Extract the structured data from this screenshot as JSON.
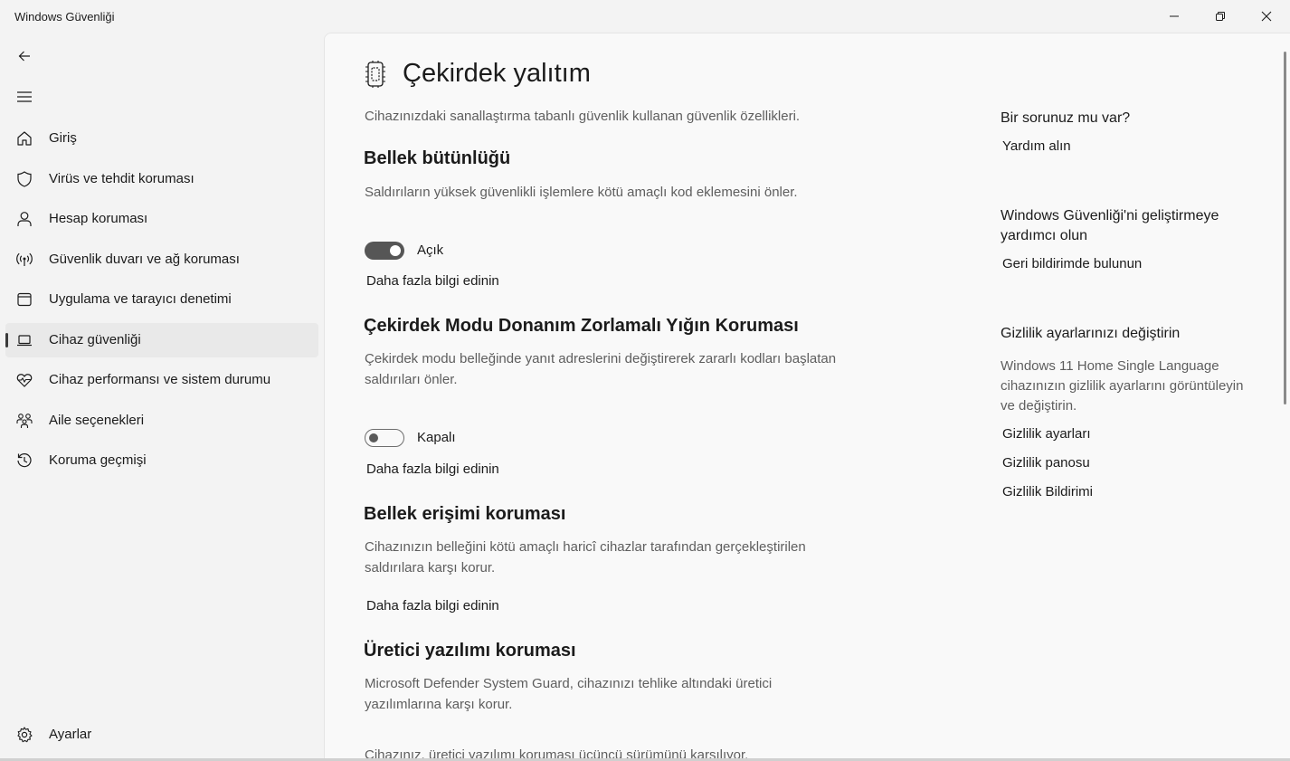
{
  "window": {
    "title": "Windows Güvenliği",
    "controls": [
      "minimize-icon",
      "restore-icon",
      "close-icon"
    ]
  },
  "sidebar": {
    "back_icon": "back-arrow-icon",
    "menu_icon": "hamburger-menu-icon",
    "items": [
      {
        "label": "Giriş",
        "icon": "home-icon"
      },
      {
        "label": "Virüs ve tehdit koruması",
        "icon": "shield-icon"
      },
      {
        "label": "Hesap koruması",
        "icon": "person-icon"
      },
      {
        "label": "Güvenlik duvarı ve ağ koruması",
        "icon": "wifi-antenna-icon"
      },
      {
        "label": "Uygulama ve tarayıcı denetimi",
        "icon": "app-window-icon"
      },
      {
        "label": "Cihaz güvenliği",
        "icon": "laptop-icon",
        "selected": true
      },
      {
        "label": "Cihaz performansı ve sistem durumu",
        "icon": "heart-pulse-icon"
      },
      {
        "label": "Aile seçenekleri",
        "icon": "family-icon"
      },
      {
        "label": "Koruma geçmişi",
        "icon": "history-icon"
      }
    ],
    "settings": {
      "label": "Ayarlar",
      "icon": "gear-icon"
    }
  },
  "main": {
    "page_title": "Çekirdek yalıtım",
    "page_icon": "core-isolation-chip-icon",
    "description": "Cihazınızdaki sanallaştırma tabanlı güvenlik kullanan güvenlik özellikleri.",
    "sections": [
      {
        "title": "Bellek bütünlüğü",
        "description": "Saldırıların yüksek güvenlikli işlemlere kötü amaçlı kod eklemesini önler.",
        "toggle_state": "on",
        "toggle_label": "Açık",
        "link": "Daha fazla bilgi edinin"
      },
      {
        "title": "Çekirdek Modu Donanım Zorlamalı Yığın Koruması",
        "description": "Çekirdek modu belleğinde yanıt adreslerini değiştirerek zararlı kodları başlatan saldırıları önler.",
        "toggle_state": "off",
        "toggle_label": "Kapalı",
        "link": "Daha fazla bilgi edinin"
      },
      {
        "title": "Bellek erişimi koruması",
        "description": "Cihazınızın belleğini kötü amaçlı haricî cihazlar tarafından gerçekleştirilen saldırılara karşı korur.",
        "link": "Daha fazla bilgi edinin"
      },
      {
        "title": "Üretici yazılımı koruması",
        "description": "Microsoft Defender System Guard, cihazınızı tehlike altındaki üretici yazılımlarına karşı korur.",
        "note": "Cihazınız, üretici yazılımı koruması üçüncü sürümünü karşılıyor."
      }
    ]
  },
  "aside": {
    "help": {
      "title": "Bir sorunuz mu var?",
      "link": "Yardım alın"
    },
    "feedback": {
      "title": "Windows Güvenliği'ni geliştirmeye yardımcı olun",
      "link": "Geri bildirimde bulunun"
    },
    "privacy": {
      "title": "Gizlilik ayarlarınızı değiştirin",
      "text": "Windows 11 Home Single Language cihazınızın gizlilik ayarlarını görüntüleyin ve değiştirin.",
      "links": [
        "Gizlilik ayarları",
        "Gizlilik panosu",
        "Gizlilik Bildirimi"
      ]
    }
  }
}
